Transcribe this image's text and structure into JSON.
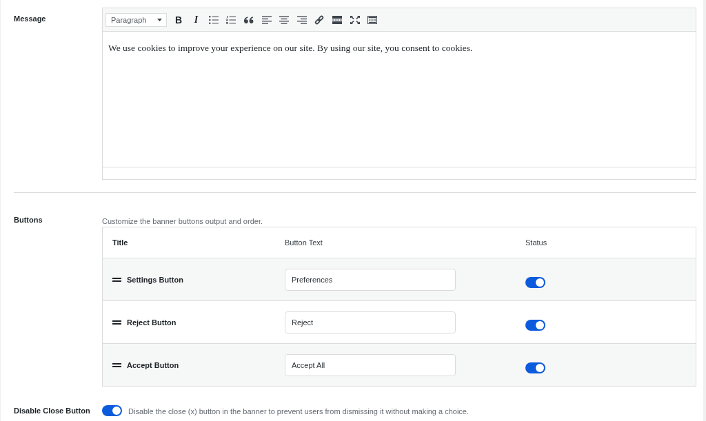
{
  "message": {
    "label": "Message",
    "editor": {
      "format": "Paragraph",
      "toolbar": [
        {
          "kind": "bold",
          "glyph": "B"
        },
        {
          "kind": "italic",
          "glyph": "I"
        },
        {
          "kind": "bullet-list"
        },
        {
          "kind": "numbered-list"
        },
        {
          "kind": "quote"
        },
        {
          "kind": "align-left"
        },
        {
          "kind": "align-center"
        },
        {
          "kind": "align-right"
        },
        {
          "kind": "link"
        },
        {
          "kind": "read-more"
        },
        {
          "kind": "fullscreen"
        },
        {
          "kind": "toolbar-toggle"
        }
      ],
      "content": "We use cookies to improve your experience on our site. By using our site, you consent to cookies."
    }
  },
  "buttons": {
    "label": "Buttons",
    "description": "Customize the banner buttons output and order.",
    "columns": [
      "Title",
      "Button Text",
      "Status"
    ],
    "rows": [
      {
        "title": "Settings Button",
        "button_text": "Preferences",
        "on": true
      },
      {
        "title": "Reject Button",
        "button_text": "Reject",
        "on": true
      },
      {
        "title": "Accept Button",
        "button_text": "Accept All",
        "on": true
      }
    ]
  },
  "disable_close_button": {
    "label": "Disable Close Button",
    "on": true,
    "description": "Disable the close (x) button in the banner to prevent users from dismissing it without making a choice."
  }
}
